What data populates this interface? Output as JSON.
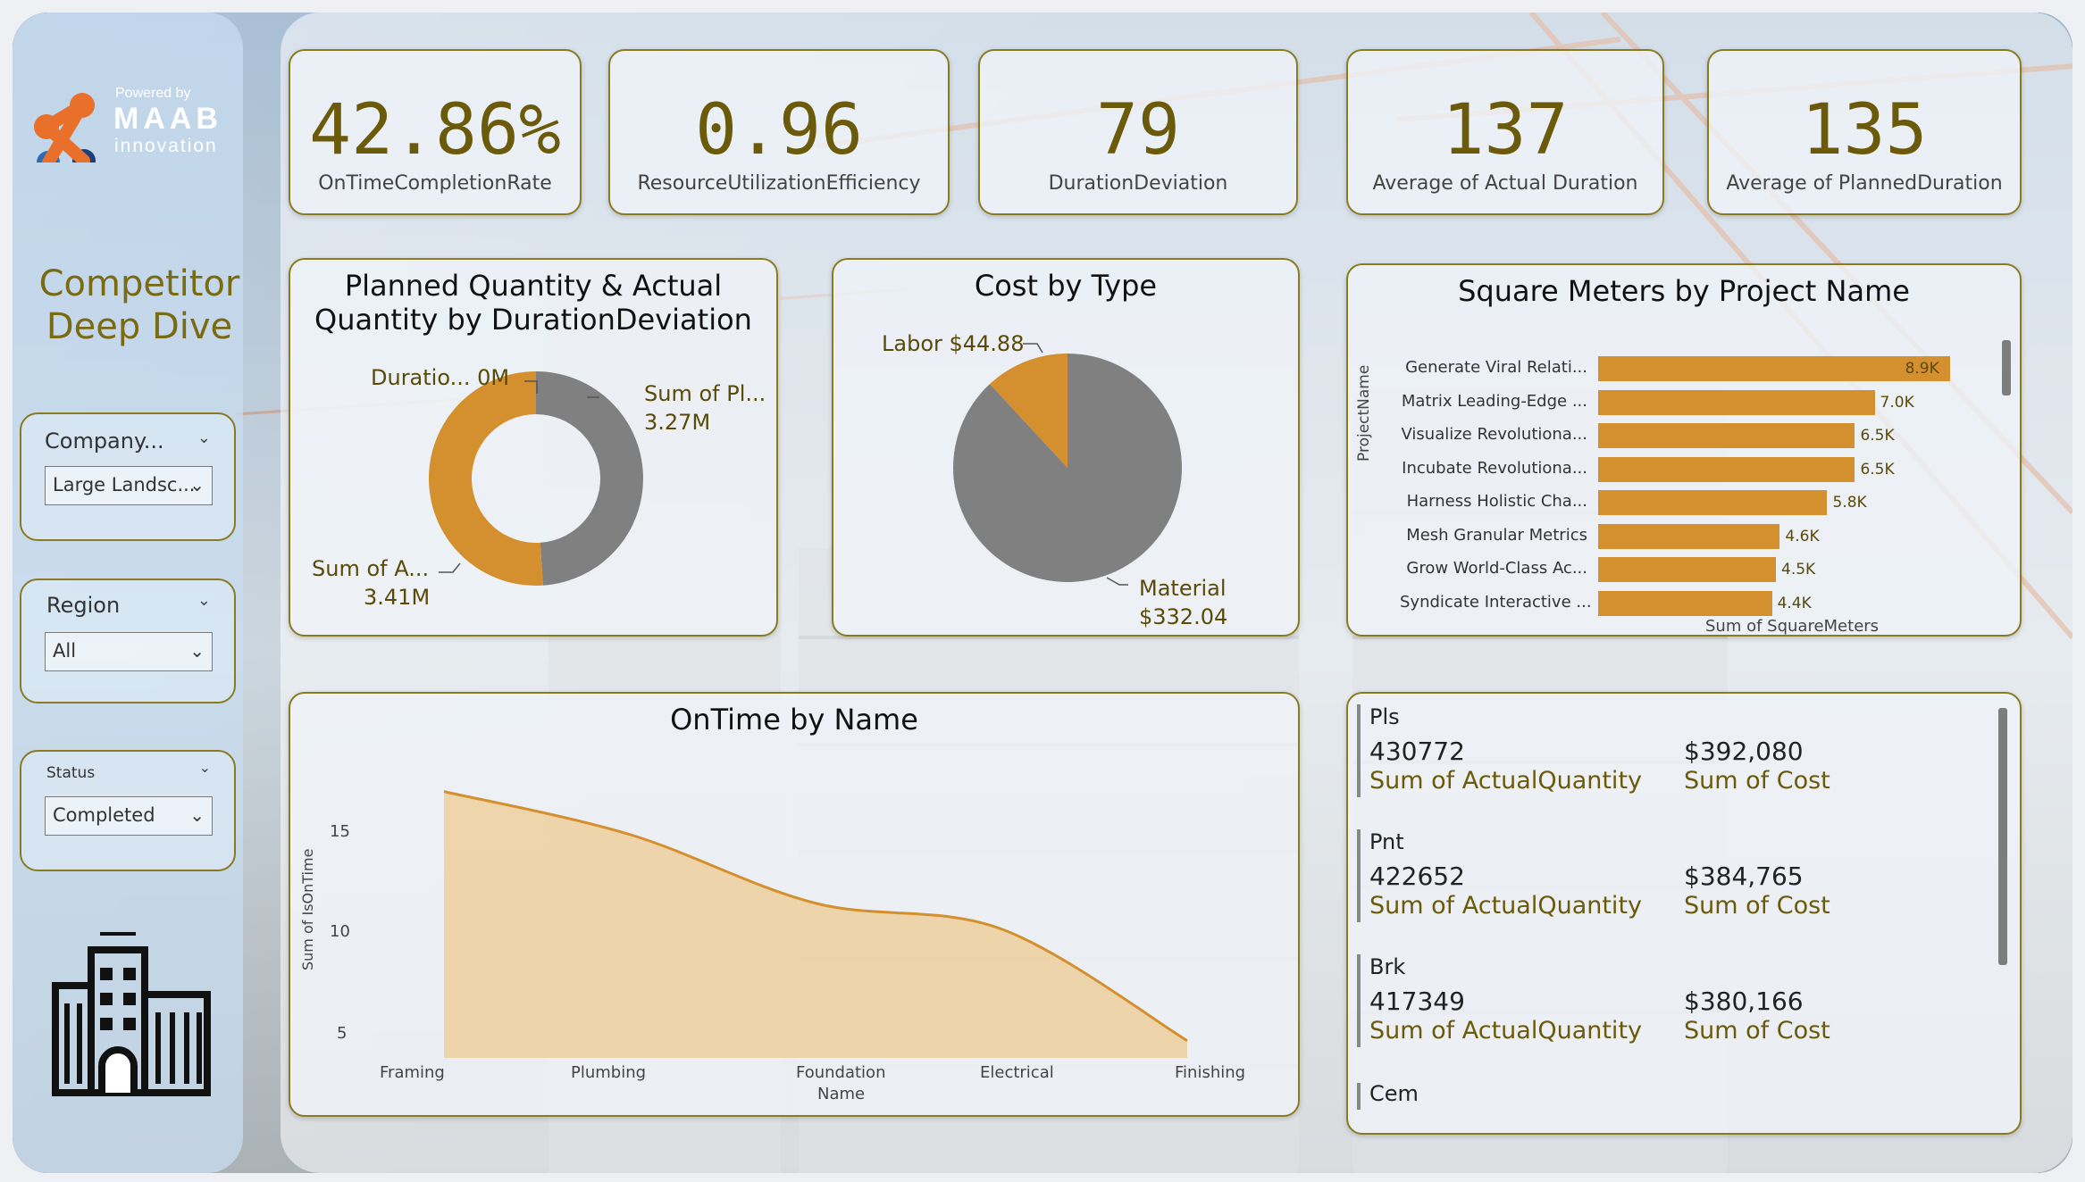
{
  "brand": {
    "powered_by": "Powered by",
    "name": "MAAB",
    "sub": "innovation"
  },
  "page_title": "Competitor Deep Dive",
  "slicers": [
    {
      "label": "Company...",
      "value": "Large Landsc..."
    },
    {
      "label": "Region",
      "value": "All"
    },
    {
      "label": "Status",
      "value": "Completed"
    }
  ],
  "kpis": [
    {
      "value": "42.86%",
      "caption": "OnTimeCompletionRate"
    },
    {
      "value": "0.96",
      "caption": "ResourceUtilizationEfficiency"
    },
    {
      "value": "79",
      "caption": "DurationDeviation"
    },
    {
      "value": "137",
      "caption": "Average of Actual Duration"
    },
    {
      "value": "135",
      "caption": "Average of PlannedDuration"
    }
  ],
  "donut": {
    "title_line1": "Planned Quantity & Actual",
    "title_line2": "Quantity by DurationDeviation",
    "label_dur": "Duratio... 0M",
    "label_planned": "Sum of Pl...",
    "label_planned_val": "3.27M",
    "label_actual": "Sum of A...",
    "label_actual_val": "3.41M"
  },
  "pie": {
    "title": "Cost by Type",
    "label_labor": "Labor $44.88",
    "label_material": "Material",
    "label_material_val": "$332.04"
  },
  "sqm": {
    "title": "Square Meters by Project Name",
    "y_axis": "ProjectName",
    "x_axis": "Sum of SquareMeters"
  },
  "ontime": {
    "title": "OnTime by Name",
    "y_axis": "Sum of IsOnTime",
    "y_ticks": [
      "15",
      "10",
      "5"
    ],
    "x_ticks": [
      "Framing",
      "Plumbing",
      "Foundation",
      "Electrical",
      "Finishing"
    ],
    "x_axis": "Name"
  },
  "mcard": [
    {
      "name": "Pls",
      "qty": "430772",
      "qty_cap": "Sum of ActualQuantity",
      "cost": "$392,080",
      "cost_cap": "Sum of Cost"
    },
    {
      "name": "Pnt",
      "qty": "422652",
      "qty_cap": "Sum of ActualQuantity",
      "cost": "$384,765",
      "cost_cap": "Sum of Cost"
    },
    {
      "name": "Brk",
      "qty": "417349",
      "qty_cap": "Sum of ActualQuantity",
      "cost": "$380,166",
      "cost_cap": "Sum of Cost"
    },
    {
      "name": "Cem"
    }
  ],
  "colors": {
    "accent": "#d4902e",
    "gray": "#808080",
    "gold_text": "#6b5a0a"
  },
  "chart_data": [
    {
      "type": "pie",
      "title": "Planned Quantity & Actual Quantity by DurationDeviation",
      "categories": [
        "Sum of ActualQuantity",
        "Sum of PlannedQuantity",
        "DurationDeviation"
      ],
      "values": [
        3.41,
        3.27,
        0
      ],
      "unit": "M"
    },
    {
      "type": "pie",
      "title": "Cost by Type",
      "categories": [
        "Labor",
        "Material"
      ],
      "values": [
        44.88,
        332.04
      ]
    },
    {
      "type": "bar",
      "title": "Square Meters by Project Name",
      "categories": [
        "Generate Viral Relati...",
        "Matrix Leading-Edge ...",
        "Visualize Revolutiona...",
        "Incubate Revolutiona...",
        "Harness Holistic Cha...",
        "Mesh Granular Metrics",
        "Grow World-Class Ac...",
        "Syndicate Interactive ..."
      ],
      "values": [
        8900,
        7000,
        6500,
        6500,
        5800,
        4600,
        4500,
        4400
      ],
      "value_labels": [
        "8.9K",
        "7.0K",
        "6.5K",
        "6.5K",
        "5.8K",
        "4.6K",
        "4.5K",
        "4.4K"
      ],
      "xlabel": "Sum of SquareMeters",
      "ylabel": "ProjectName",
      "xlim": [
        0,
        9000
      ]
    },
    {
      "type": "area",
      "title": "OnTime by Name",
      "categories": [
        "Framing",
        "Plumbing",
        "Foundation",
        "Electrical",
        "Finishing"
      ],
      "values": [
        17.5,
        15,
        11,
        9.5,
        3
      ],
      "xlabel": "Name",
      "ylabel": "Sum of IsOnTime",
      "ylim": [
        2,
        18
      ]
    }
  ]
}
